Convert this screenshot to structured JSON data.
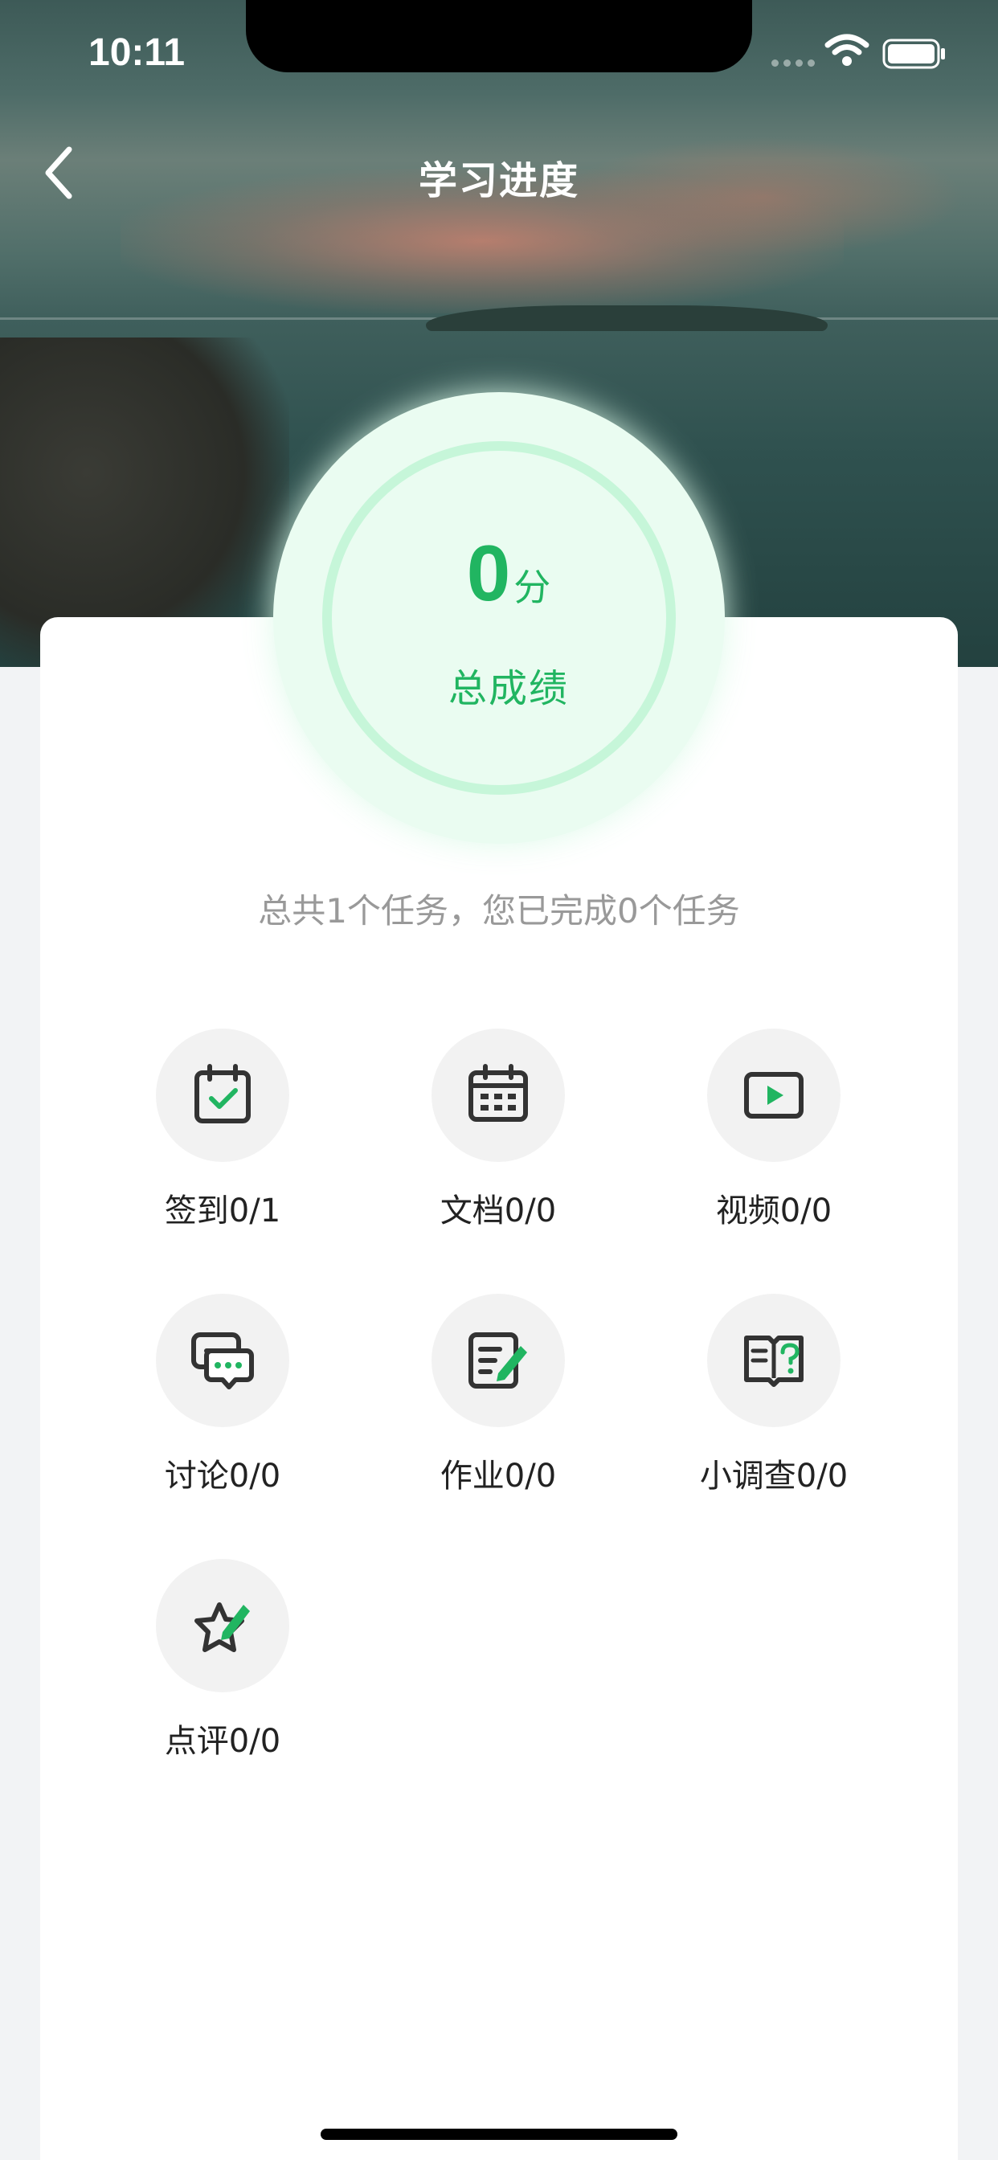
{
  "status_bar": {
    "time": "10:11"
  },
  "nav": {
    "title": "学习进度"
  },
  "score": {
    "value": "0",
    "unit": "分",
    "label": "总成绩"
  },
  "summary": "总共1个任务，您已完成0个任务",
  "tasks": [
    {
      "label": "签到0/1",
      "icon": "calendar-check-icon"
    },
    {
      "label": "文档0/0",
      "icon": "calendar-grid-icon"
    },
    {
      "label": "视频0/0",
      "icon": "video-play-icon"
    },
    {
      "label": "讨论0/0",
      "icon": "chat-bubbles-icon"
    },
    {
      "label": "作业0/0",
      "icon": "document-edit-icon"
    },
    {
      "label": "小调查0/0",
      "icon": "survey-question-icon"
    },
    {
      "label": "点评0/0",
      "icon": "star-edit-icon"
    }
  ],
  "colors": {
    "accent": "#21b561",
    "ring": "#c6f6d9",
    "icon": "#333333"
  }
}
